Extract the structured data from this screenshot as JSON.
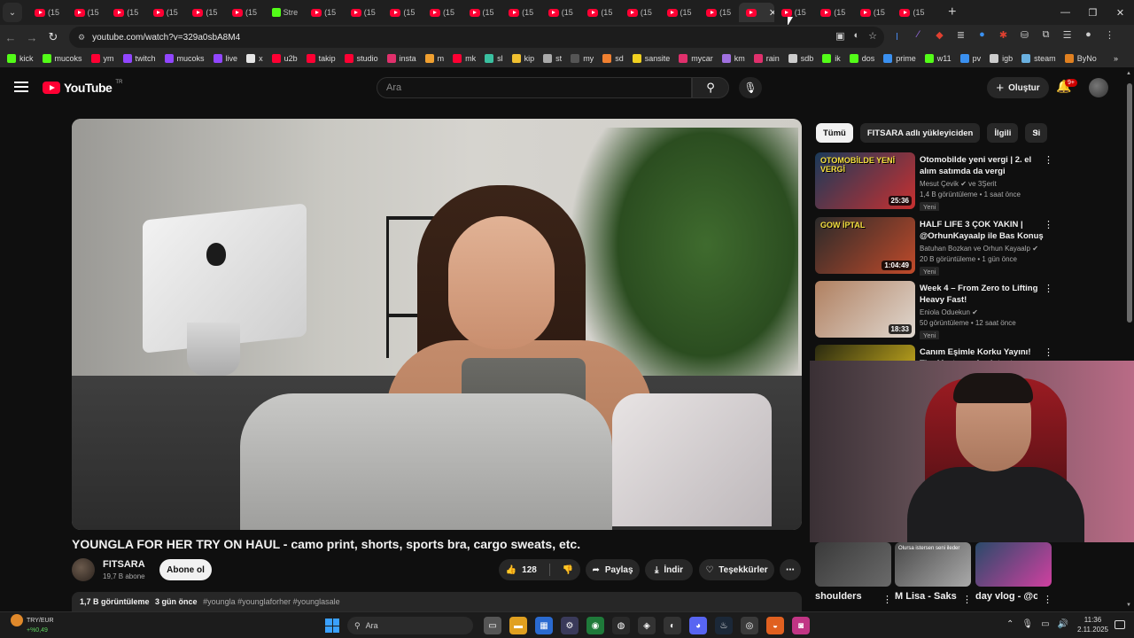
{
  "browser": {
    "tabs": [
      {
        "label": "(15",
        "icon": "youtube-icon"
      },
      {
        "label": "(15",
        "icon": "youtube-icon"
      },
      {
        "label": "(15",
        "icon": "youtube-icon"
      },
      {
        "label": "(15",
        "icon": "youtube-icon"
      },
      {
        "label": "(15",
        "icon": "youtube-icon"
      },
      {
        "label": "(15",
        "icon": "youtube-icon"
      },
      {
        "label": "Stre",
        "icon": "kick-icon"
      },
      {
        "label": "(15",
        "icon": "youtube-icon"
      },
      {
        "label": "(15",
        "icon": "youtube-icon"
      },
      {
        "label": "(15",
        "icon": "youtube-icon"
      },
      {
        "label": "(15",
        "icon": "youtube-icon"
      },
      {
        "label": "(15",
        "icon": "youtube-icon"
      },
      {
        "label": "(15",
        "icon": "youtube-icon"
      },
      {
        "label": "(15",
        "icon": "youtube-icon"
      },
      {
        "label": "(15",
        "icon": "youtube-icon"
      },
      {
        "label": "(15",
        "icon": "youtube-icon"
      },
      {
        "label": "(15",
        "icon": "youtube-icon"
      },
      {
        "label": "(15",
        "icon": "youtube-icon"
      },
      {
        "label": "",
        "icon": "youtube-icon",
        "active": true
      },
      {
        "label": "(15",
        "icon": "youtube-icon"
      },
      {
        "label": "(15",
        "icon": "youtube-icon"
      },
      {
        "label": "(15",
        "icon": "youtube-icon"
      },
      {
        "label": "(15",
        "icon": "youtube-icon"
      }
    ],
    "url": "youtube.com/watch?v=329a0sbA8M4",
    "bookmarks": [
      {
        "label": "kick",
        "color": "#53fc18"
      },
      {
        "label": "mucoks",
        "color": "#53fc18"
      },
      {
        "label": "ym",
        "color": "#ff0033"
      },
      {
        "label": "twitch",
        "color": "#9146ff"
      },
      {
        "label": "mucoks",
        "color": "#9146ff"
      },
      {
        "label": "live",
        "color": "#9146ff"
      },
      {
        "label": "x",
        "color": "#e6e6e6"
      },
      {
        "label": "u2b",
        "color": "#ff0033"
      },
      {
        "label": "takip",
        "color": "#ff0033"
      },
      {
        "label": "studio",
        "color": "#ff0033"
      },
      {
        "label": "insta",
        "color": "#e1306c"
      },
      {
        "label": "m",
        "color": "#f0a030"
      },
      {
        "label": "mk",
        "color": "#ff0033"
      },
      {
        "label": "sl",
        "color": "#3ac0a0"
      },
      {
        "label": "kip",
        "color": "#f0c030"
      },
      {
        "label": "st",
        "color": "#aaaaaa"
      },
      {
        "label": "my",
        "color": "#555555"
      },
      {
        "label": "sd",
        "color": "#f08030"
      },
      {
        "label": "sansite",
        "color": "#f0d020"
      },
      {
        "label": "mycar",
        "color": "#e0306c"
      },
      {
        "label": "km",
        "color": "#a070e0"
      },
      {
        "label": "rain",
        "color": "#e0306c"
      },
      {
        "label": "sdb",
        "color": "#cccccc"
      },
      {
        "label": "ik",
        "color": "#53fc18"
      },
      {
        "label": "dos",
        "color": "#53fc18"
      },
      {
        "label": "prime",
        "color": "#3a90f0"
      },
      {
        "label": "w11",
        "color": "#53fc18"
      },
      {
        "label": "pv",
        "color": "#3a90f0"
      },
      {
        "label": "igb",
        "color": "#cccccc"
      },
      {
        "label": "steam",
        "color": "#6ab0e0"
      },
      {
        "label": "ByNo",
        "color": "#e08020"
      }
    ]
  },
  "youtube": {
    "search_placeholder": "Ara",
    "create_label": "Oluştur",
    "notif_count": "9+",
    "logo_text": "YouTube",
    "logo_region": "TR",
    "video": {
      "title": "YOUNGLA FOR HER TRY ON HAUL - camo print, shorts, sports bra, cargo sweats, etc.",
      "channel": "FITSARA",
      "subscribers": "19,7 B abone",
      "subscribe_label": "Abone ol",
      "likes": "128",
      "share_label": "Paylaş",
      "download_label": "İndir",
      "thanks_label": "Teşekkürler",
      "views": "1,7 B görüntüleme",
      "age": "3 gün önce",
      "tags": "#youngla #younglaforher #younglasale"
    },
    "chips": [
      "Tümü",
      "FITSARA adlı yükleyiciden",
      "İlgili",
      "Si"
    ],
    "recommendations": [
      {
        "title": "Otomobilde yeni vergi | 2. el alım satımda da vergi alınacak...",
        "channel": "Mesut Çevik",
        "channel_extra": "ve 3Şerit",
        "views": "1,4 B görüntüleme",
        "age": "1 saat önce",
        "badge": "Yeni",
        "duration": "25:36",
        "colors": [
          "#1a3a5a",
          "#c83030"
        ],
        "thumb_text": "OTOMOBİLDE YENİ VERGİ"
      },
      {
        "title": "HALF LIFE 3 ÇOK YAKIN | @OrhunKayaalp ile Bas Konuş ...",
        "channel": "Batuhan Bozkan ve Orhun Kayaalp",
        "channel_extra": "",
        "views": "20 B görüntüleme",
        "age": "1 gün önce",
        "badge": "Yeni",
        "duration": "1:04:49",
        "colors": [
          "#2a2a2a",
          "#c04a2a"
        ],
        "thumb_text": "GOW İPTAL"
      },
      {
        "title": "Week 4 – From Zero to Lifting Heavy Fast!",
        "channel": "Eniola Oduekun",
        "channel_extra": "",
        "views": "50 görüntüleme",
        "age": "12 saat önce",
        "badge": "Yeni",
        "duration": "18:33",
        "colors": [
          "#b08060",
          "#e0d8d0"
        ],
        "thumb_text": ""
      },
      {
        "title": "Canım Eşimle Korku Yayını! The Mortuary Assistant Oynuyoruz",
        "channel": "",
        "channel_extra": "",
        "views": "",
        "age": "",
        "badge": "",
        "duration": "",
        "colors": [
          "#2a2a10",
          "#e0c020"
        ],
        "thumb_text": ""
      }
    ],
    "shorts": [
      {
        "title": "shoulders",
        "colors": [
          "#3a3a3a",
          "#6a6a6a"
        ],
        "overlay": ""
      },
      {
        "title": "M Lisa - Sakso Sakso",
        "colors": [
          "#4a4a4a",
          "#aaaaaa"
        ],
        "overlay": "Olursa istersen seni ileder"
      },
      {
        "title": "day vlog - @ohplob",
        "colors": [
          "#2a4a6a",
          "#d040a0"
        ],
        "overlay": ""
      }
    ]
  },
  "taskbar": {
    "weather_label": "TRY/EUR",
    "weather_change": "+%0,49",
    "search_label": "Ara",
    "time": "11:36",
    "date": "2.11.2025"
  }
}
